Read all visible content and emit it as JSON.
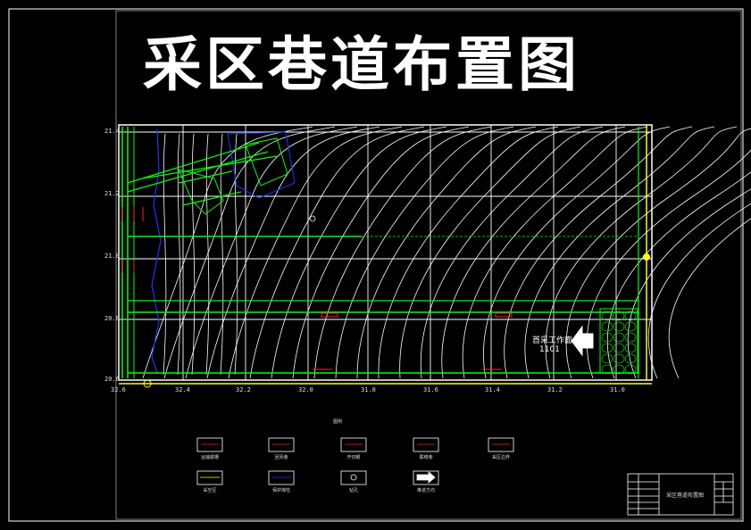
{
  "title": "采区巷道布置图",
  "y_ticks": [
    "21.4",
    "21.2",
    "21.0",
    "20.8",
    "20.6"
  ],
  "x_ticks": [
    "32.6",
    "32.4",
    "32.2",
    "32.0",
    "31.8",
    "31.6",
    "31.4",
    "31.2",
    "31.0"
  ],
  "panel": {
    "label_top": "首采工作面",
    "label_bottom": "1101"
  },
  "legend": {
    "heading": "图例",
    "items": [
      {
        "label": "运输顺槽"
      },
      {
        "label": "回风巷"
      },
      {
        "label": "开切眼"
      },
      {
        "label": "联络巷"
      },
      {
        "label": "采区边界"
      },
      {
        "label": "采空区"
      },
      {
        "label": "保护煤柱"
      },
      {
        "label": "钻孔"
      },
      {
        "label": "推进方向"
      }
    ]
  },
  "title_block": {
    "drawing_name": "采区巷道布置图"
  },
  "colors": {
    "background": "#000000",
    "border": "#ffffff",
    "contour": "#ffffff",
    "roadway": "#00ff00",
    "boundary": "#2233ff",
    "marker": "#ff2020",
    "axis_yellow": "#ffff00",
    "arrow": "#ffffff"
  }
}
